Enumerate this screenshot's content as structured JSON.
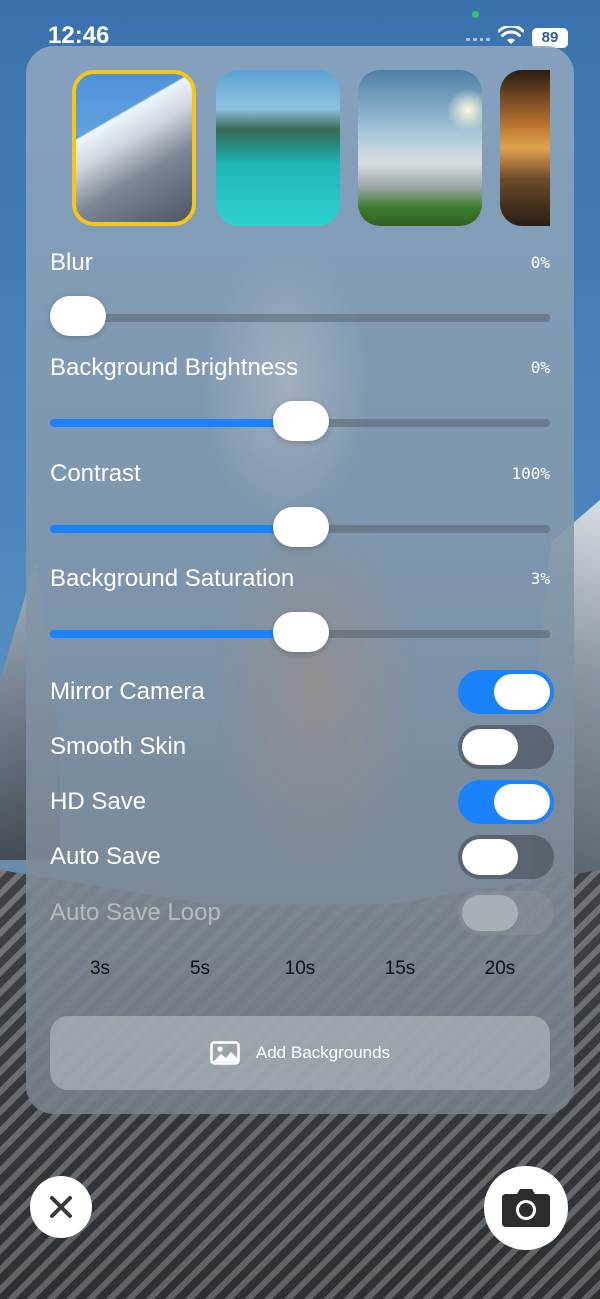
{
  "status_bar": {
    "time": "12:46",
    "battery": "89",
    "icons": [
      "signal-icon",
      "wifi-icon",
      "battery-icon"
    ]
  },
  "backgrounds": [
    {
      "name": "mountain-peak",
      "selected": true
    },
    {
      "name": "turquoise-lake",
      "selected": false
    },
    {
      "name": "tree-sunset",
      "selected": false
    },
    {
      "name": "golden-lake",
      "selected": false
    }
  ],
  "sliders": {
    "blur": {
      "label": "Blur",
      "value": "0%",
      "level": 0
    },
    "brightness": {
      "label": "Background Brightness",
      "value": "0%",
      "level": 0.5
    },
    "contrast": {
      "label": "Contrast",
      "value": "100%",
      "level": 0.5
    },
    "saturation": {
      "label": "Background Saturation",
      "value": "3%",
      "level": 0.5
    }
  },
  "toggles": {
    "mirror_camera": {
      "label": "Mirror Camera",
      "on": true
    },
    "smooth_skin": {
      "label": "Smooth Skin",
      "on": false
    },
    "hd_save": {
      "label": "HD Save",
      "on": true
    },
    "auto_save": {
      "label": "Auto Save",
      "on": false
    },
    "auto_save_loop": {
      "label": "Auto Save Loop",
      "on": false,
      "disabled": true
    }
  },
  "intervals": [
    "3s",
    "5s",
    "10s",
    "15s",
    "20s"
  ],
  "add_backgrounds": {
    "label": "Add Backgrounds",
    "icon": "photo-icon"
  },
  "bottom": {
    "close_icon": "close-icon",
    "camera_icon": "camera-icon"
  },
  "colors": {
    "accent": "#1a82fb",
    "selected_border": "#f5c518"
  }
}
